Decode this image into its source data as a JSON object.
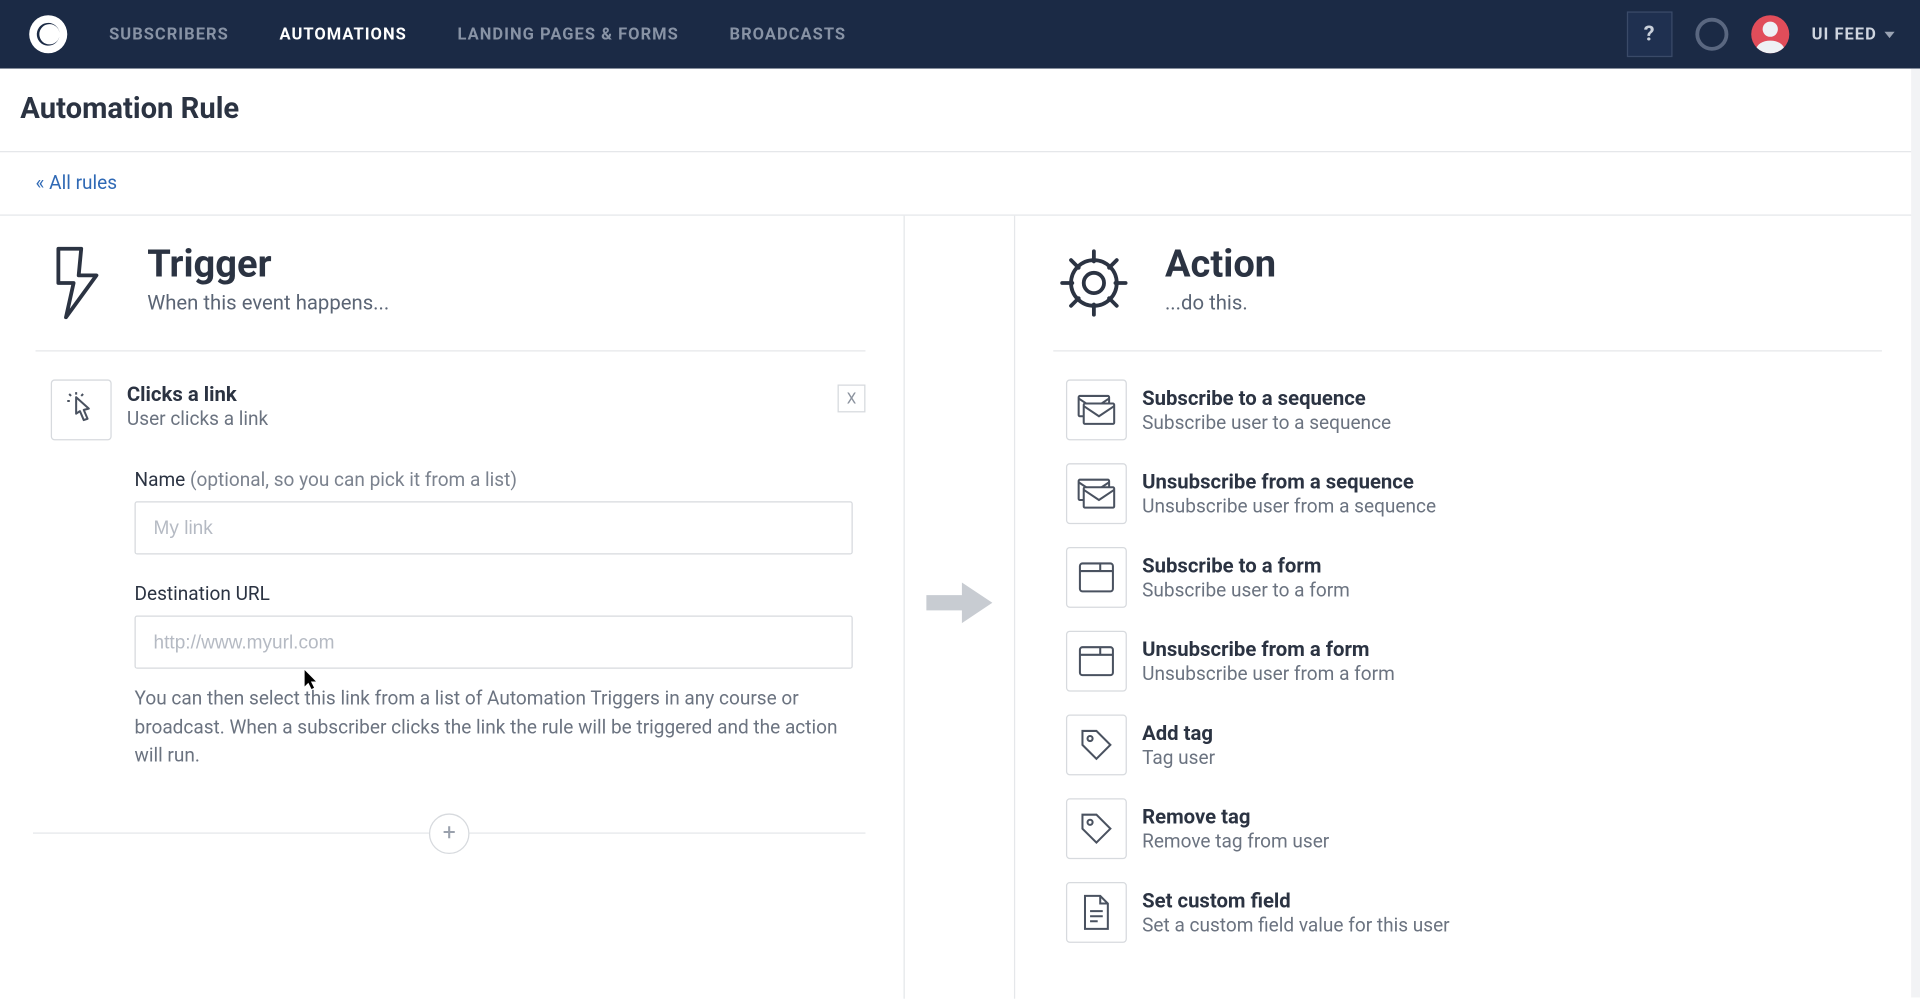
{
  "nav": {
    "items": [
      {
        "label": "SUBSCRIBERS",
        "active": false
      },
      {
        "label": "AUTOMATIONS",
        "active": true
      },
      {
        "label": "LANDING PAGES & FORMS",
        "active": false
      },
      {
        "label": "BROADCASTS",
        "active": false
      }
    ],
    "help_symbol": "?",
    "user_label": "UI FEED"
  },
  "page": {
    "title": "Automation Rule",
    "back_link": "« All rules"
  },
  "trigger": {
    "heading": "Trigger",
    "subheading": "When this event happens...",
    "card_title": "Clicks a link",
    "card_sub": "User clicks a link",
    "remove_label": "X",
    "name_label": "Name",
    "name_hint": " (optional, so you can pick it from a list)",
    "name_placeholder": "My link",
    "url_label": "Destination URL",
    "url_placeholder": "http://www.myurl.com",
    "help_text": "You can then select this link from a list of Automation Triggers in any course or broadcast. When a subscriber clicks the link the rule will be triggered and the action will run.",
    "plus_label": "+"
  },
  "action": {
    "heading": "Action",
    "subheading": "...do this.",
    "items": [
      {
        "title": "Subscribe to a sequence",
        "sub": "Subscribe user to a sequence",
        "icon": "mail-stack-icon"
      },
      {
        "title": "Unsubscribe from a sequence",
        "sub": "Unsubscribe user from a sequence",
        "icon": "mail-stack-icon"
      },
      {
        "title": "Subscribe to a form",
        "sub": "Subscribe user to a form",
        "icon": "window-icon"
      },
      {
        "title": "Unsubscribe from a form",
        "sub": "Unsubscribe user from a form",
        "icon": "window-icon"
      },
      {
        "title": "Add tag",
        "sub": "Tag user",
        "icon": "tag-icon"
      },
      {
        "title": "Remove tag",
        "sub": "Remove tag from user",
        "icon": "tag-icon"
      },
      {
        "title": "Set custom field",
        "sub": "Set a custom field value for this user",
        "icon": "doc-icon"
      }
    ]
  }
}
